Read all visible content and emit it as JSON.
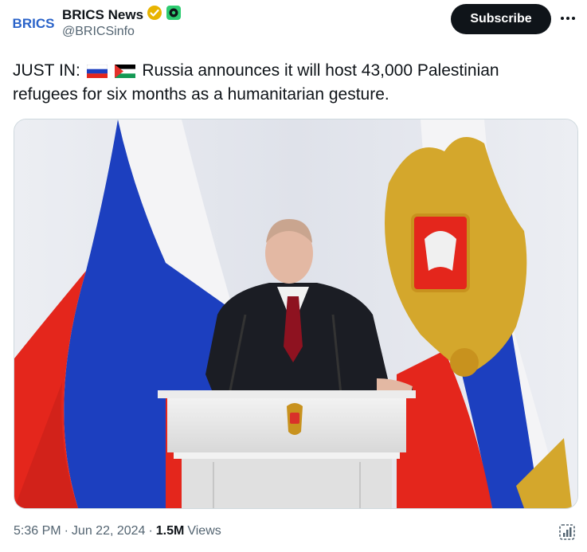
{
  "post": {
    "author": {
      "display_name": "BRICS News",
      "handle": "@BRICSinfo",
      "avatar_text": "BRICS",
      "verified_badge_color": "#e8b400",
      "affiliate_badge_color": "#2ecc71"
    },
    "subscribe_label": "Subscribe",
    "more_icon": "more-horizontal-icon",
    "text": {
      "prefix": "JUST IN:",
      "flags": [
        "russia-flag",
        "palestine-flag"
      ],
      "line1_rest": "Russia announces it will host 43,000 Palestinian",
      "line2": "refugees for six months as a humanitarian gesture."
    },
    "meta": {
      "time": "5:36 PM",
      "sep1": "·",
      "date": "Jun 22, 2024",
      "sep2": "·",
      "views_count": "1.5M",
      "views_label": "Views"
    },
    "analytics_icon": "analytics-icon"
  },
  "colors": {
    "subscribe_bg": "#0f1419",
    "secondary_text": "#536471",
    "russia_white": "#ffffff",
    "russia_blue": "#1c3fbf",
    "russia_red": "#e4261c",
    "coat_gold": "#d4a72c"
  }
}
